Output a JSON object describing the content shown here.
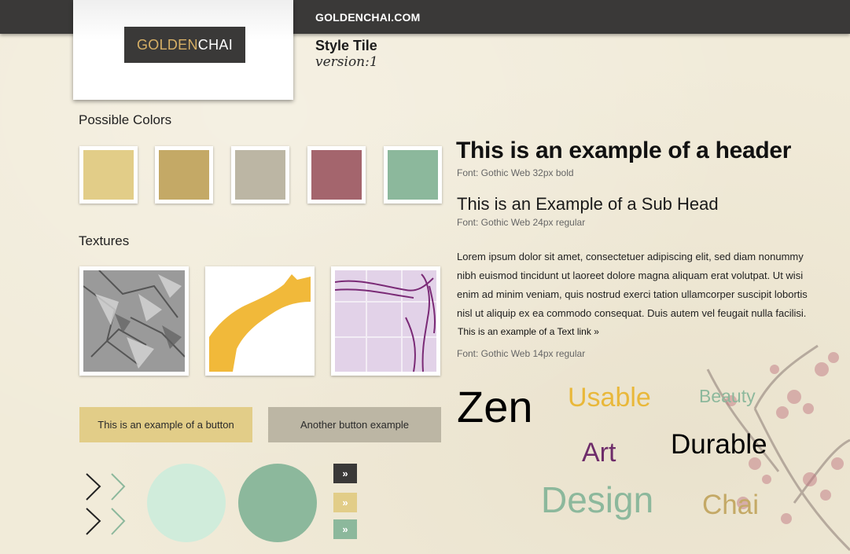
{
  "header": {
    "site_name": "GOLDENCHAI.COM"
  },
  "logo": {
    "part1": "GOLDEN",
    "part2": "CHAI",
    "gold_color": "#d7b066"
  },
  "style_tile": {
    "title": "Style Tile",
    "version": "version:1"
  },
  "colors": {
    "label": "Possible Colors",
    "swatches": [
      "#e2cd88",
      "#c4a966",
      "#bcb6a4",
      "#a4656d",
      "#8cb89c"
    ]
  },
  "textures": {
    "label": "Textures",
    "items": [
      "gray-crumpled-texture",
      "yellow-brush-stroke-texture",
      "purple-sketch-texture"
    ]
  },
  "buttons": {
    "primary_label": "This is an example of a button",
    "secondary_label": "Another button example",
    "primary_color": "#e2cd88",
    "secondary_color": "#bcb6a4"
  },
  "ui_elements": {
    "arrow_glyph": "»",
    "circle_colors": [
      "#d0ecdb",
      "#8cb89c"
    ],
    "arrow_button_colors": [
      "#3a3938",
      "#e2cd88",
      "#8cb89c"
    ]
  },
  "typography": {
    "header_example": "This is an example of a header",
    "header_font": "Font: Gothic Web 32px bold",
    "subhead_example": "This is an Example of a Sub Head",
    "subhead_font": "Font: Gothic Web 24px regular",
    "body": "Lorem ipsum dolor sit amet, consectetuer adipiscing elit, sed diam nonummy nibh euismod tincidunt ut laoreet dolore magna aliquam erat volutpat. Ut wisi enim ad minim veniam, quis nostrud exerci tation ullamcorper suscipit lobortis nisl ut aliquip ex ea commodo consequat. Duis autem vel feugait nulla facilisi.",
    "text_link": "This is an example of a Text link »",
    "body_font": "Font: Gothic Web 14px regular"
  },
  "word_cloud": [
    {
      "text": "Zen",
      "color": "#000000"
    },
    {
      "text": "Usable",
      "color": "#e9b83a"
    },
    {
      "text": "Beauty",
      "color": "#8cb89c"
    },
    {
      "text": "Art",
      "color": "#6e2c6a"
    },
    {
      "text": "Durable",
      "color": "#000000"
    },
    {
      "text": "Design",
      "color": "#8cb89c"
    },
    {
      "text": "Chai",
      "color": "#c4a966"
    }
  ]
}
